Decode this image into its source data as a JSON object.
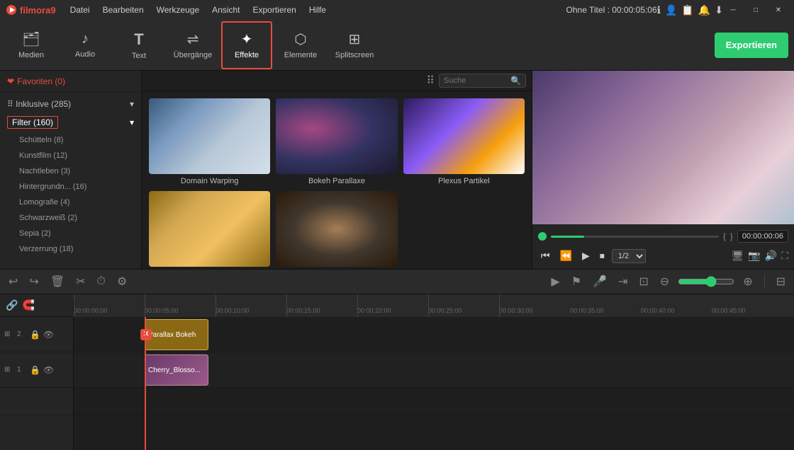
{
  "app": {
    "name": "filmora9",
    "logo": "▶",
    "title": "Ohne Titel : 00:00:05:06"
  },
  "menu": {
    "items": [
      "Datei",
      "Bearbeiten",
      "Werkzeuge",
      "Ansicht",
      "Exportieren",
      "Hilfe"
    ]
  },
  "toolbar": {
    "buttons": [
      {
        "id": "medien",
        "label": "Medien",
        "icon": "🗂"
      },
      {
        "id": "audio",
        "label": "Audio",
        "icon": "♪"
      },
      {
        "id": "text",
        "label": "Text",
        "icon": "T"
      },
      {
        "id": "uebergaenge",
        "label": "Übergänge",
        "icon": "⇌"
      },
      {
        "id": "effekte",
        "label": "Effekte",
        "icon": "✦"
      },
      {
        "id": "elemente",
        "label": "Elemente",
        "icon": "⬡"
      },
      {
        "id": "splitscreen",
        "label": "Splitscreen",
        "icon": "⊞"
      }
    ],
    "export_label": "Exportieren",
    "active": "effekte"
  },
  "sidebar": {
    "favorites": "❤ Favoriten (0)",
    "categories": [
      {
        "label": "Inklusive (285)",
        "expanded": true,
        "children": []
      },
      {
        "label": "Filter (160)",
        "expanded": true,
        "selected": true,
        "children": [
          {
            "label": "Schütteln (8)"
          },
          {
            "label": "Kunstfilm (12)"
          },
          {
            "label": "Nachtleben (3)"
          },
          {
            "label": "Hintergrundn... (16)"
          },
          {
            "label": "Lomografie (4)"
          },
          {
            "label": "Schwarzweiß (2)"
          },
          {
            "label": "Sepia (2)"
          },
          {
            "label": "Verzerrung (18)"
          }
        ]
      }
    ]
  },
  "effects": {
    "search_placeholder": "Suche",
    "grid": [
      {
        "name": "Domain Warping",
        "thumb": "domain"
      },
      {
        "name": "Bokeh Parallaxe",
        "thumb": "bokeh"
      },
      {
        "name": "Plexus Partikel",
        "thumb": "plexus"
      },
      {
        "name": "",
        "thumb": "scales"
      },
      {
        "name": "",
        "thumb": "bokeh2"
      }
    ]
  },
  "preview": {
    "time": "00:00:00:06",
    "quality": "1/2"
  },
  "bottom_toolbar": {
    "undo": "↩",
    "redo": "↪",
    "delete": "🗑",
    "cut": "✂",
    "speed": "⏱",
    "audio_adj": "⚙"
  },
  "timeline": {
    "ruler_marks": [
      "00:00:00:00",
      "00:00:05:00",
      "00:00:10:00",
      "00:00:15:00",
      "00:00:20:00",
      "00:00:25:00",
      "00:00:30:00",
      "00:00:35:00",
      "00:00:40:00",
      "00:00:45:00"
    ],
    "tracks": [
      {
        "num": "2",
        "icons": [
          "⊞",
          "🔒",
          "👁"
        ]
      },
      {
        "num": "1",
        "icons": [
          "⊞",
          "🔒",
          "👁"
        ]
      }
    ],
    "clips": [
      {
        "label": "Parallax Bokeh",
        "track": 0,
        "type": "parallax"
      },
      {
        "label": "Cherry_Blosso...",
        "track": 1,
        "type": "cherry"
      }
    ]
  }
}
